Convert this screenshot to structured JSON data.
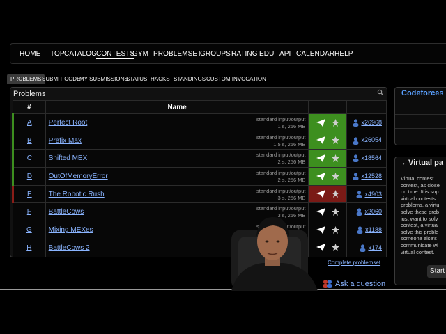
{
  "nav": {
    "items": [
      "HOME",
      "TOP",
      "CATALOG",
      "CONTESTS",
      "GYM",
      "PROBLEMSET",
      "GROUPS",
      "RATING",
      "EDU",
      "API",
      "CALENDAR",
      "HELP"
    ],
    "active": "CONTESTS"
  },
  "tabs": {
    "items": [
      "PROBLEMS",
      "SUBMIT CODE",
      "MY SUBMISSIONS",
      "STATUS",
      "HACKS",
      "STANDINGS",
      "CUSTOM INVOCATION"
    ],
    "active": "PROBLEMS"
  },
  "problems": {
    "title": "Problems",
    "header_id": "#",
    "header_name": "Name",
    "rows": [
      {
        "id": "A",
        "name": "Perfect Root",
        "io": "standard input/output",
        "limits": "1 s, 256 MB",
        "solved": "x26968",
        "status": "accepted"
      },
      {
        "id": "B",
        "name": "Prefix Max",
        "io": "standard input/output",
        "limits": "1.5 s, 256 MB",
        "solved": "x26054",
        "status": "accepted"
      },
      {
        "id": "C",
        "name": "Shifted MEX",
        "io": "standard input/output",
        "limits": "2 s, 256 MB",
        "solved": "x18564",
        "status": "accepted"
      },
      {
        "id": "D",
        "name": "OutOfMemoryError",
        "io": "standard input/output",
        "limits": "2 s, 256 MB",
        "solved": "x12528",
        "status": "accepted"
      },
      {
        "id": "E",
        "name": "The Robotic Rush",
        "io": "standard input/output",
        "limits": "3 s, 256 MB",
        "solved": "x4903",
        "status": "rejected"
      },
      {
        "id": "F",
        "name": "BattleCows",
        "io": "standard input/output",
        "limits": "3 s, 256 MB",
        "solved": "x2060",
        "status": "none"
      },
      {
        "id": "G",
        "name": "Mixing MEXes",
        "io": "standard input/output",
        "limits": "",
        "solved": "x1188",
        "status": "none"
      },
      {
        "id": "H",
        "name": "BattleCows 2",
        "io": "",
        "limits": "",
        "solved": "x174",
        "status": "none"
      }
    ],
    "complete_link": "Complete problemset"
  },
  "sidebar": {
    "box1_title": "Codeforces",
    "box2_title": "→ Virtual pa",
    "box2_lines": [
      "Virtual contest i",
      "contest, as close",
      "on time. It is sup",
      "virtual contests.",
      "problems, a virtu",
      "solve these prob",
      "just want to solv",
      "contest, a virtua",
      "solve this proble",
      "someone else's",
      "communicate wi",
      "virtual contest."
    ],
    "start_button": "Start"
  },
  "ask_question": "Ask a question",
  "colors": {
    "accepted": "#3d8f1f",
    "rejected": "#7a1a16",
    "link": "#8ab4ff"
  }
}
